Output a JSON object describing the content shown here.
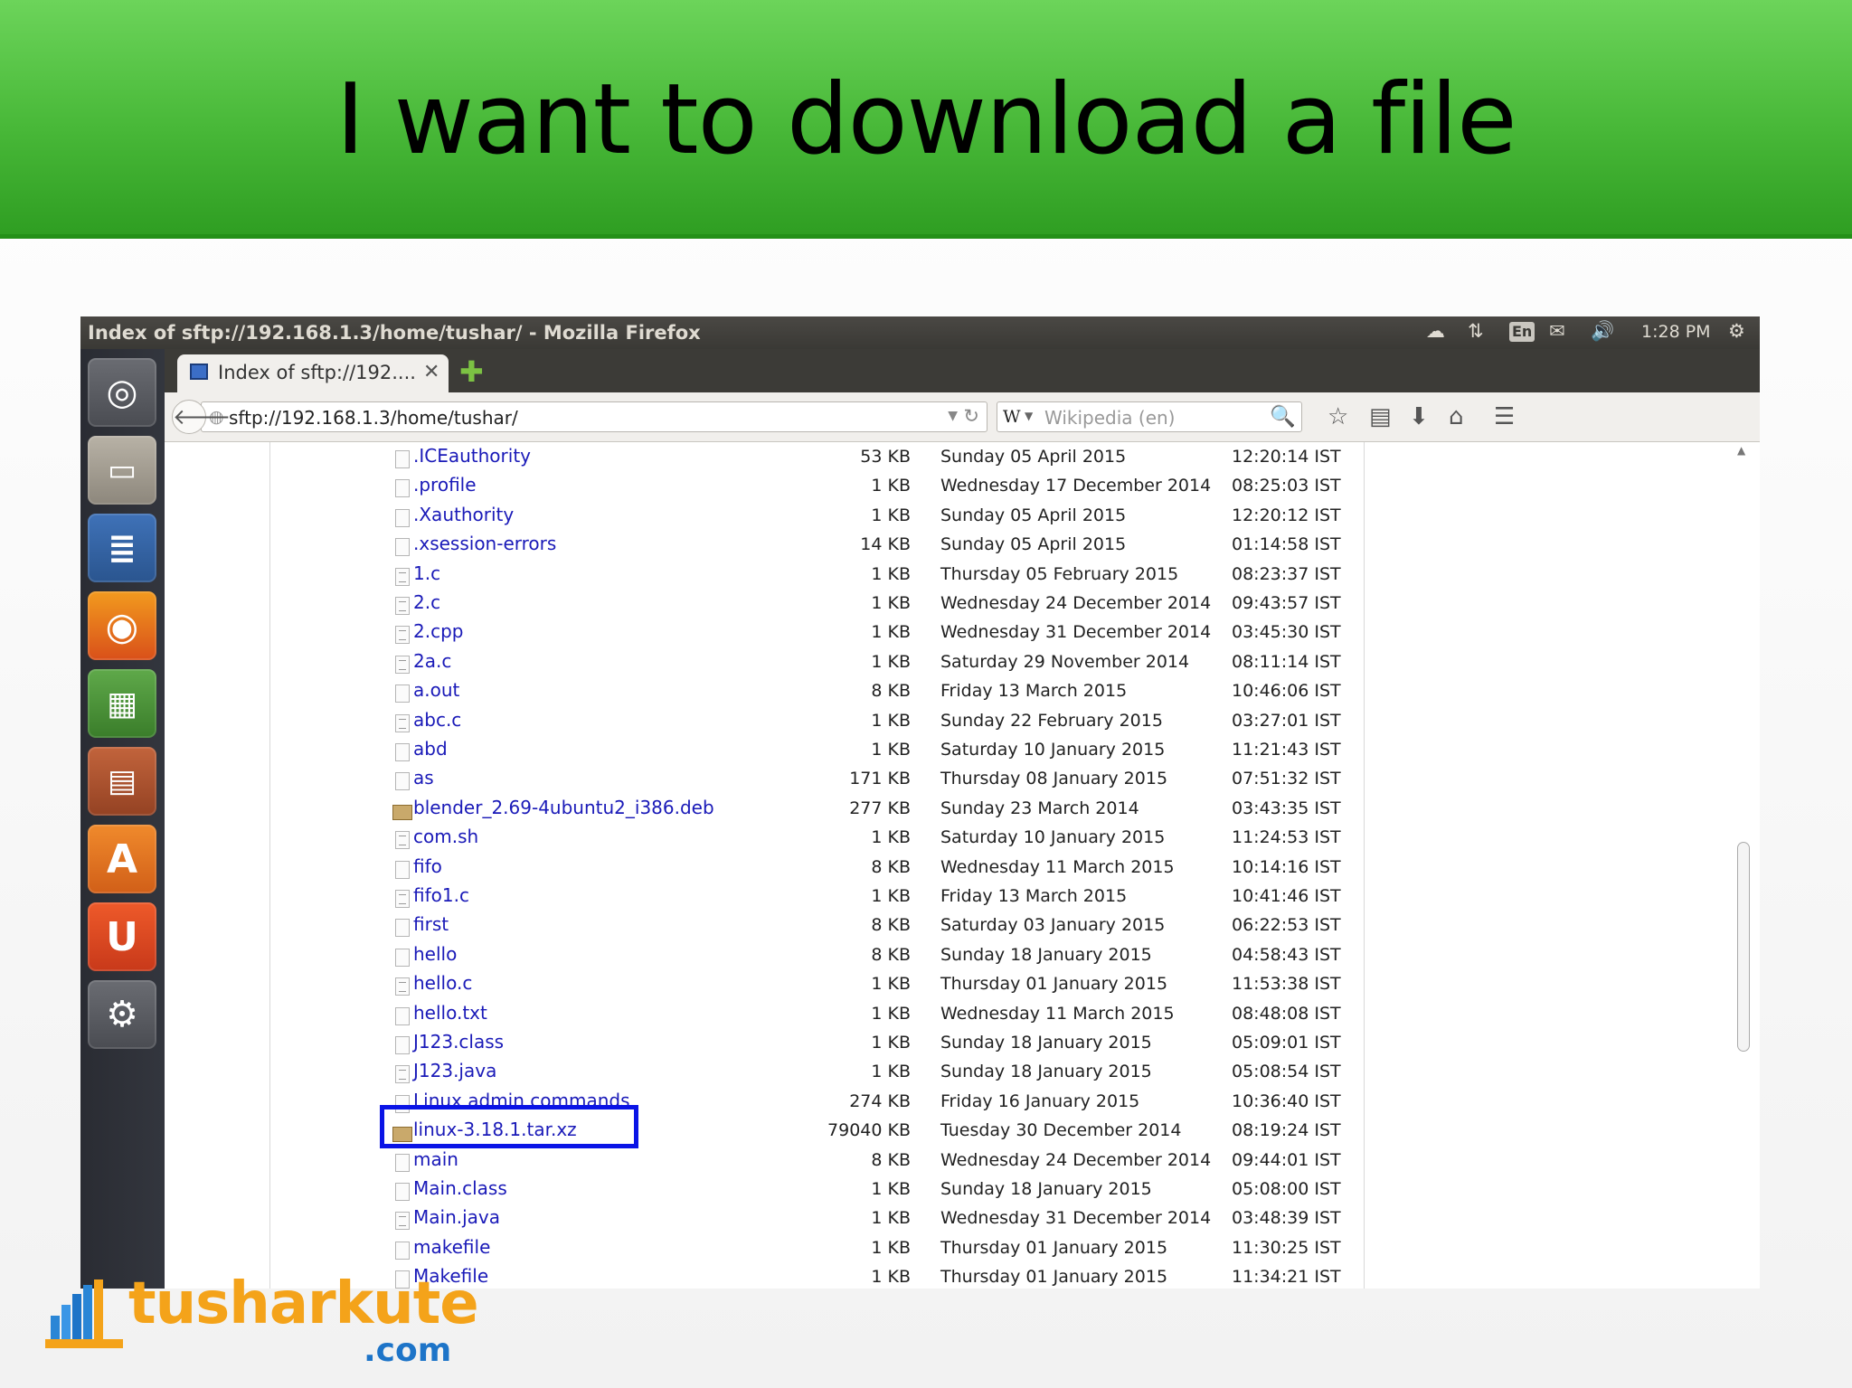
{
  "slide": {
    "title": "I want to download a file"
  },
  "window": {
    "title": "Index of sftp://192.168.1.3/home/tushar/ - Mozilla Firefox"
  },
  "tray": {
    "lang": "En",
    "time": "1:28 PM"
  },
  "tab": {
    "title": "Index of sftp://192...."
  },
  "navbar": {
    "url": "sftp://192.168.1.3/home/tushar/",
    "search_engine": "W",
    "search_placeholder": "Wikipedia (en)"
  },
  "files": [
    {
      "name": ".ICEauthority",
      "size": "53 KB",
      "date": "Sunday 05 April 2015",
      "time": "12:20:14 IST",
      "icon": "blank-file-icon"
    },
    {
      "name": ".profile",
      "size": "1 KB",
      "date": "Wednesday 17 December 2014",
      "time": "08:25:03 IST",
      "icon": "blank-file-icon"
    },
    {
      "name": ".Xauthority",
      "size": "1 KB",
      "date": "Sunday 05 April 2015",
      "time": "12:20:12 IST",
      "icon": "blank-file-icon"
    },
    {
      "name": ".xsession-errors",
      "size": "14 KB",
      "date": "Sunday 05 April 2015",
      "time": "01:14:58 IST",
      "icon": "blank-file-icon"
    },
    {
      "name": "1.c",
      "size": "1 KB",
      "date": "Thursday 05 February 2015",
      "time": "08:23:37 IST",
      "icon": "text-file-icon"
    },
    {
      "name": "2.c",
      "size": "1 KB",
      "date": "Wednesday 24 December 2014",
      "time": "09:43:57 IST",
      "icon": "text-file-icon"
    },
    {
      "name": "2.cpp",
      "size": "1 KB",
      "date": "Wednesday 31 December 2014",
      "time": "03:45:30 IST",
      "icon": "text-file-icon"
    },
    {
      "name": "2a.c",
      "size": "1 KB",
      "date": "Saturday 29 November 2014",
      "time": "08:11:14 IST",
      "icon": "text-file-icon"
    },
    {
      "name": "a.out",
      "size": "8 KB",
      "date": "Friday 13 March 2015",
      "time": "10:46:06 IST",
      "icon": "blank-file-icon"
    },
    {
      "name": "abc.c",
      "size": "1 KB",
      "date": "Sunday 22 February 2015",
      "time": "03:27:01 IST",
      "icon": "text-file-icon"
    },
    {
      "name": "abd",
      "size": "1 KB",
      "date": "Saturday 10 January 2015",
      "time": "11:21:43 IST",
      "icon": "blank-file-icon"
    },
    {
      "name": "as",
      "size": "171 KB",
      "date": "Thursday 08 January 2015",
      "time": "07:51:32 IST",
      "icon": "blank-file-icon"
    },
    {
      "name": "blender_2.69-4ubuntu2_i386.deb",
      "size": "277 KB",
      "date": "Sunday 23 March 2014",
      "time": "03:43:35 IST",
      "icon": "archive-file-icon"
    },
    {
      "name": "com.sh",
      "size": "1 KB",
      "date": "Saturday 10 January 2015",
      "time": "11:24:53 IST",
      "icon": "text-file-icon"
    },
    {
      "name": "fifo",
      "size": "8 KB",
      "date": "Wednesday 11 March 2015",
      "time": "10:14:16 IST",
      "icon": "blank-file-icon"
    },
    {
      "name": "fifo1.c",
      "size": "1 KB",
      "date": "Friday 13 March 2015",
      "time": "10:41:46 IST",
      "icon": "text-file-icon"
    },
    {
      "name": "first",
      "size": "8 KB",
      "date": "Saturday 03 January 2015",
      "time": "06:22:53 IST",
      "icon": "blank-file-icon"
    },
    {
      "name": "hello",
      "size": "8 KB",
      "date": "Sunday 18 January 2015",
      "time": "04:58:43 IST",
      "icon": "blank-file-icon"
    },
    {
      "name": "hello.c",
      "size": "1 KB",
      "date": "Thursday 01 January 2015",
      "time": "11:53:38 IST",
      "icon": "text-file-icon"
    },
    {
      "name": "hello.txt",
      "size": "1 KB",
      "date": "Wednesday 11 March 2015",
      "time": "08:48:08 IST",
      "icon": "blank-file-icon"
    },
    {
      "name": "J123.class",
      "size": "1 KB",
      "date": "Sunday 18 January 2015",
      "time": "05:09:01 IST",
      "icon": "blank-file-icon"
    },
    {
      "name": "J123.java",
      "size": "1 KB",
      "date": "Sunday 18 January 2015",
      "time": "05:08:54 IST",
      "icon": "text-file-icon"
    },
    {
      "name": "Linux admin commands",
      "size": "274 KB",
      "date": "Friday 16 January 2015",
      "time": "10:36:40 IST",
      "icon": "blank-file-icon"
    },
    {
      "name": "linux-3.18.1.tar.xz",
      "size": "79040 KB",
      "date": "Tuesday 30 December 2014",
      "time": "08:19:24 IST",
      "icon": "archive-file-icon"
    },
    {
      "name": "main",
      "size": "8 KB",
      "date": "Wednesday 24 December 2014",
      "time": "09:44:01 IST",
      "icon": "blank-file-icon"
    },
    {
      "name": "Main.class",
      "size": "1 KB",
      "date": "Sunday 18 January 2015",
      "time": "05:08:00 IST",
      "icon": "blank-file-icon"
    },
    {
      "name": "Main.java",
      "size": "1 KB",
      "date": "Wednesday 31 December 2014",
      "time": "03:48:39 IST",
      "icon": "text-file-icon"
    },
    {
      "name": "makefile",
      "size": "1 KB",
      "date": "Thursday 01 January 2015",
      "time": "11:30:25 IST",
      "icon": "blank-file-icon"
    },
    {
      "name": "Makefile",
      "size": "1 KB",
      "date": "Thursday 01 January 2015",
      "time": "11:34:21 IST",
      "icon": "blank-file-icon"
    }
  ],
  "highlighted_file": "linux-3.18.1.tar.xz",
  "colors": {
    "banner": "#48b838",
    "link": "#1a1ab8",
    "highlight": "#0a14e6",
    "brand": "#f4a31a"
  },
  "brand": {
    "name": "tusharkute",
    "tld": ".com"
  }
}
